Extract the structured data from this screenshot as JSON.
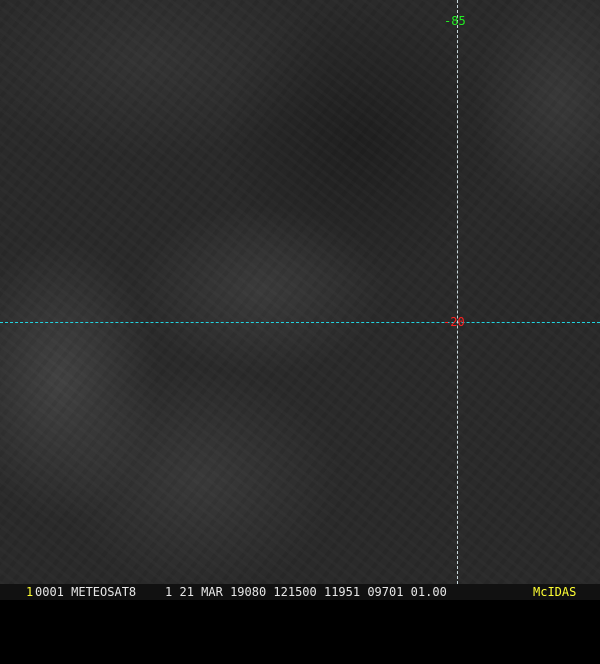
{
  "grid": {
    "latitude_label": "-20",
    "longitude_label": "-85",
    "line_color": "#22d4e0"
  },
  "status_bar": {
    "frame_number": "1",
    "info": "0001 METEOSAT8    1 21 MAR 19080 121500 11951 09701 01.00",
    "logo": "McIDAS"
  },
  "colors": {
    "lat_label": "#ff2020",
    "lon_label": "#22ee22",
    "logo": "#ffff33"
  }
}
